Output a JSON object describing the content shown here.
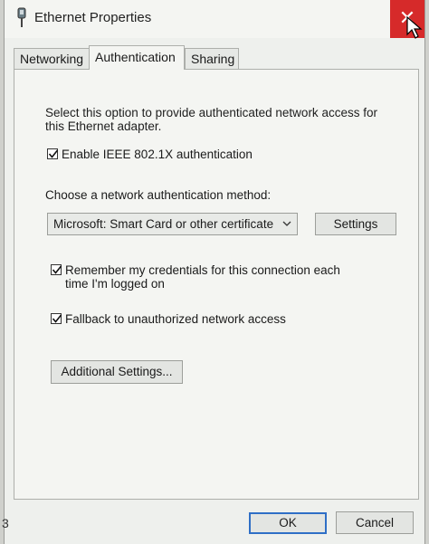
{
  "window": {
    "title": "Ethernet Properties",
    "close_glyph": "✕"
  },
  "tabs": [
    {
      "label": "Networking",
      "active": false
    },
    {
      "label": "Authentication",
      "active": true
    },
    {
      "label": "Sharing",
      "active": false
    }
  ],
  "authentication": {
    "description": "Select this option to provide authenticated network access for this Ethernet adapter.",
    "enable_8021x": {
      "label": "Enable IEEE 802.1X authentication",
      "checked": true
    },
    "method_label": "Choose a network authentication method:",
    "method_select": {
      "value": "Microsoft: Smart Card or other certificate"
    },
    "settings_button": "Settings",
    "remember_credentials": {
      "label": "Remember my credentials for this connection each time I'm logged on",
      "checked": true
    },
    "fallback": {
      "label": "Fallback to unauthorized network access",
      "checked": true
    },
    "additional_settings_button": "Additional Settings..."
  },
  "footer": {
    "ok_label": "OK",
    "cancel_label": "Cancel"
  },
  "page_number": "3",
  "colors": {
    "close": "#d62a2a",
    "ok_border": "#2f6fc6"
  }
}
